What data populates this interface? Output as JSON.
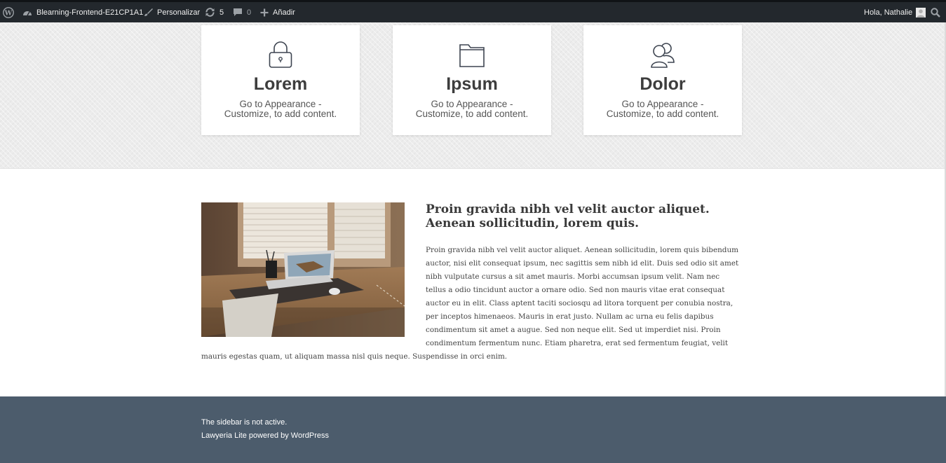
{
  "adminbar": {
    "site_name": "Blearning-Frontend-E21CP1A1",
    "customize_label": "Personalizar",
    "updates_count": "5",
    "comments_count": "0",
    "add_label": "Añadir",
    "greeting": "Hola, Nathalie"
  },
  "services": [
    {
      "title": "Lorem",
      "description": "Go to Appearance - Customize, to add content.",
      "icon": "lock-icon"
    },
    {
      "title": "Ipsum",
      "description": "Go to Appearance - Customize, to add content.",
      "icon": "folder-icon"
    },
    {
      "title": "Dolor",
      "description": "Go to Appearance - Customize, to add content.",
      "icon": "users-icon"
    }
  ],
  "about": {
    "heading": "Proin gravida nibh vel velit auctor aliquet. Aenean sollicitudin, lorem quis.",
    "body": "Proin gravida nibh vel velit auctor aliquet. Aenean sollicitudin, lorem quis bibendum auctor, nisi elit consequat ipsum, nec sagittis sem nibh id elit. Duis sed odio sit amet nibh vulputate cursus a sit amet mauris. Morbi accumsan ipsum velit. Nam nec tellus a odio tincidunt auctor a ornare odio. Sed non mauris vitae erat consequat auctor eu in elit. Class aptent taciti sociosqu ad litora torquent per conubia nostra, per inceptos himenaeos. Mauris in erat justo. Nullam ac urna eu felis dapibus condimentum sit amet a augue. Sed non neque elit. Sed ut imperdiet nisi. Proin condimentum fermentum nunc. Etiam pharetra, erat sed fermentum feugiat, velit",
    "body_tail": "mauris egestas quam, ut aliquam massa nisl quis neque. Suspendisse in orci enim."
  },
  "footer": {
    "sidebar_notice": "The sidebar is not active.",
    "credit": "Lawyeria Lite powered by WordPress"
  },
  "colors": {
    "adminbar_bg": "#23282d",
    "footer_bg": "#4c5c6c"
  }
}
